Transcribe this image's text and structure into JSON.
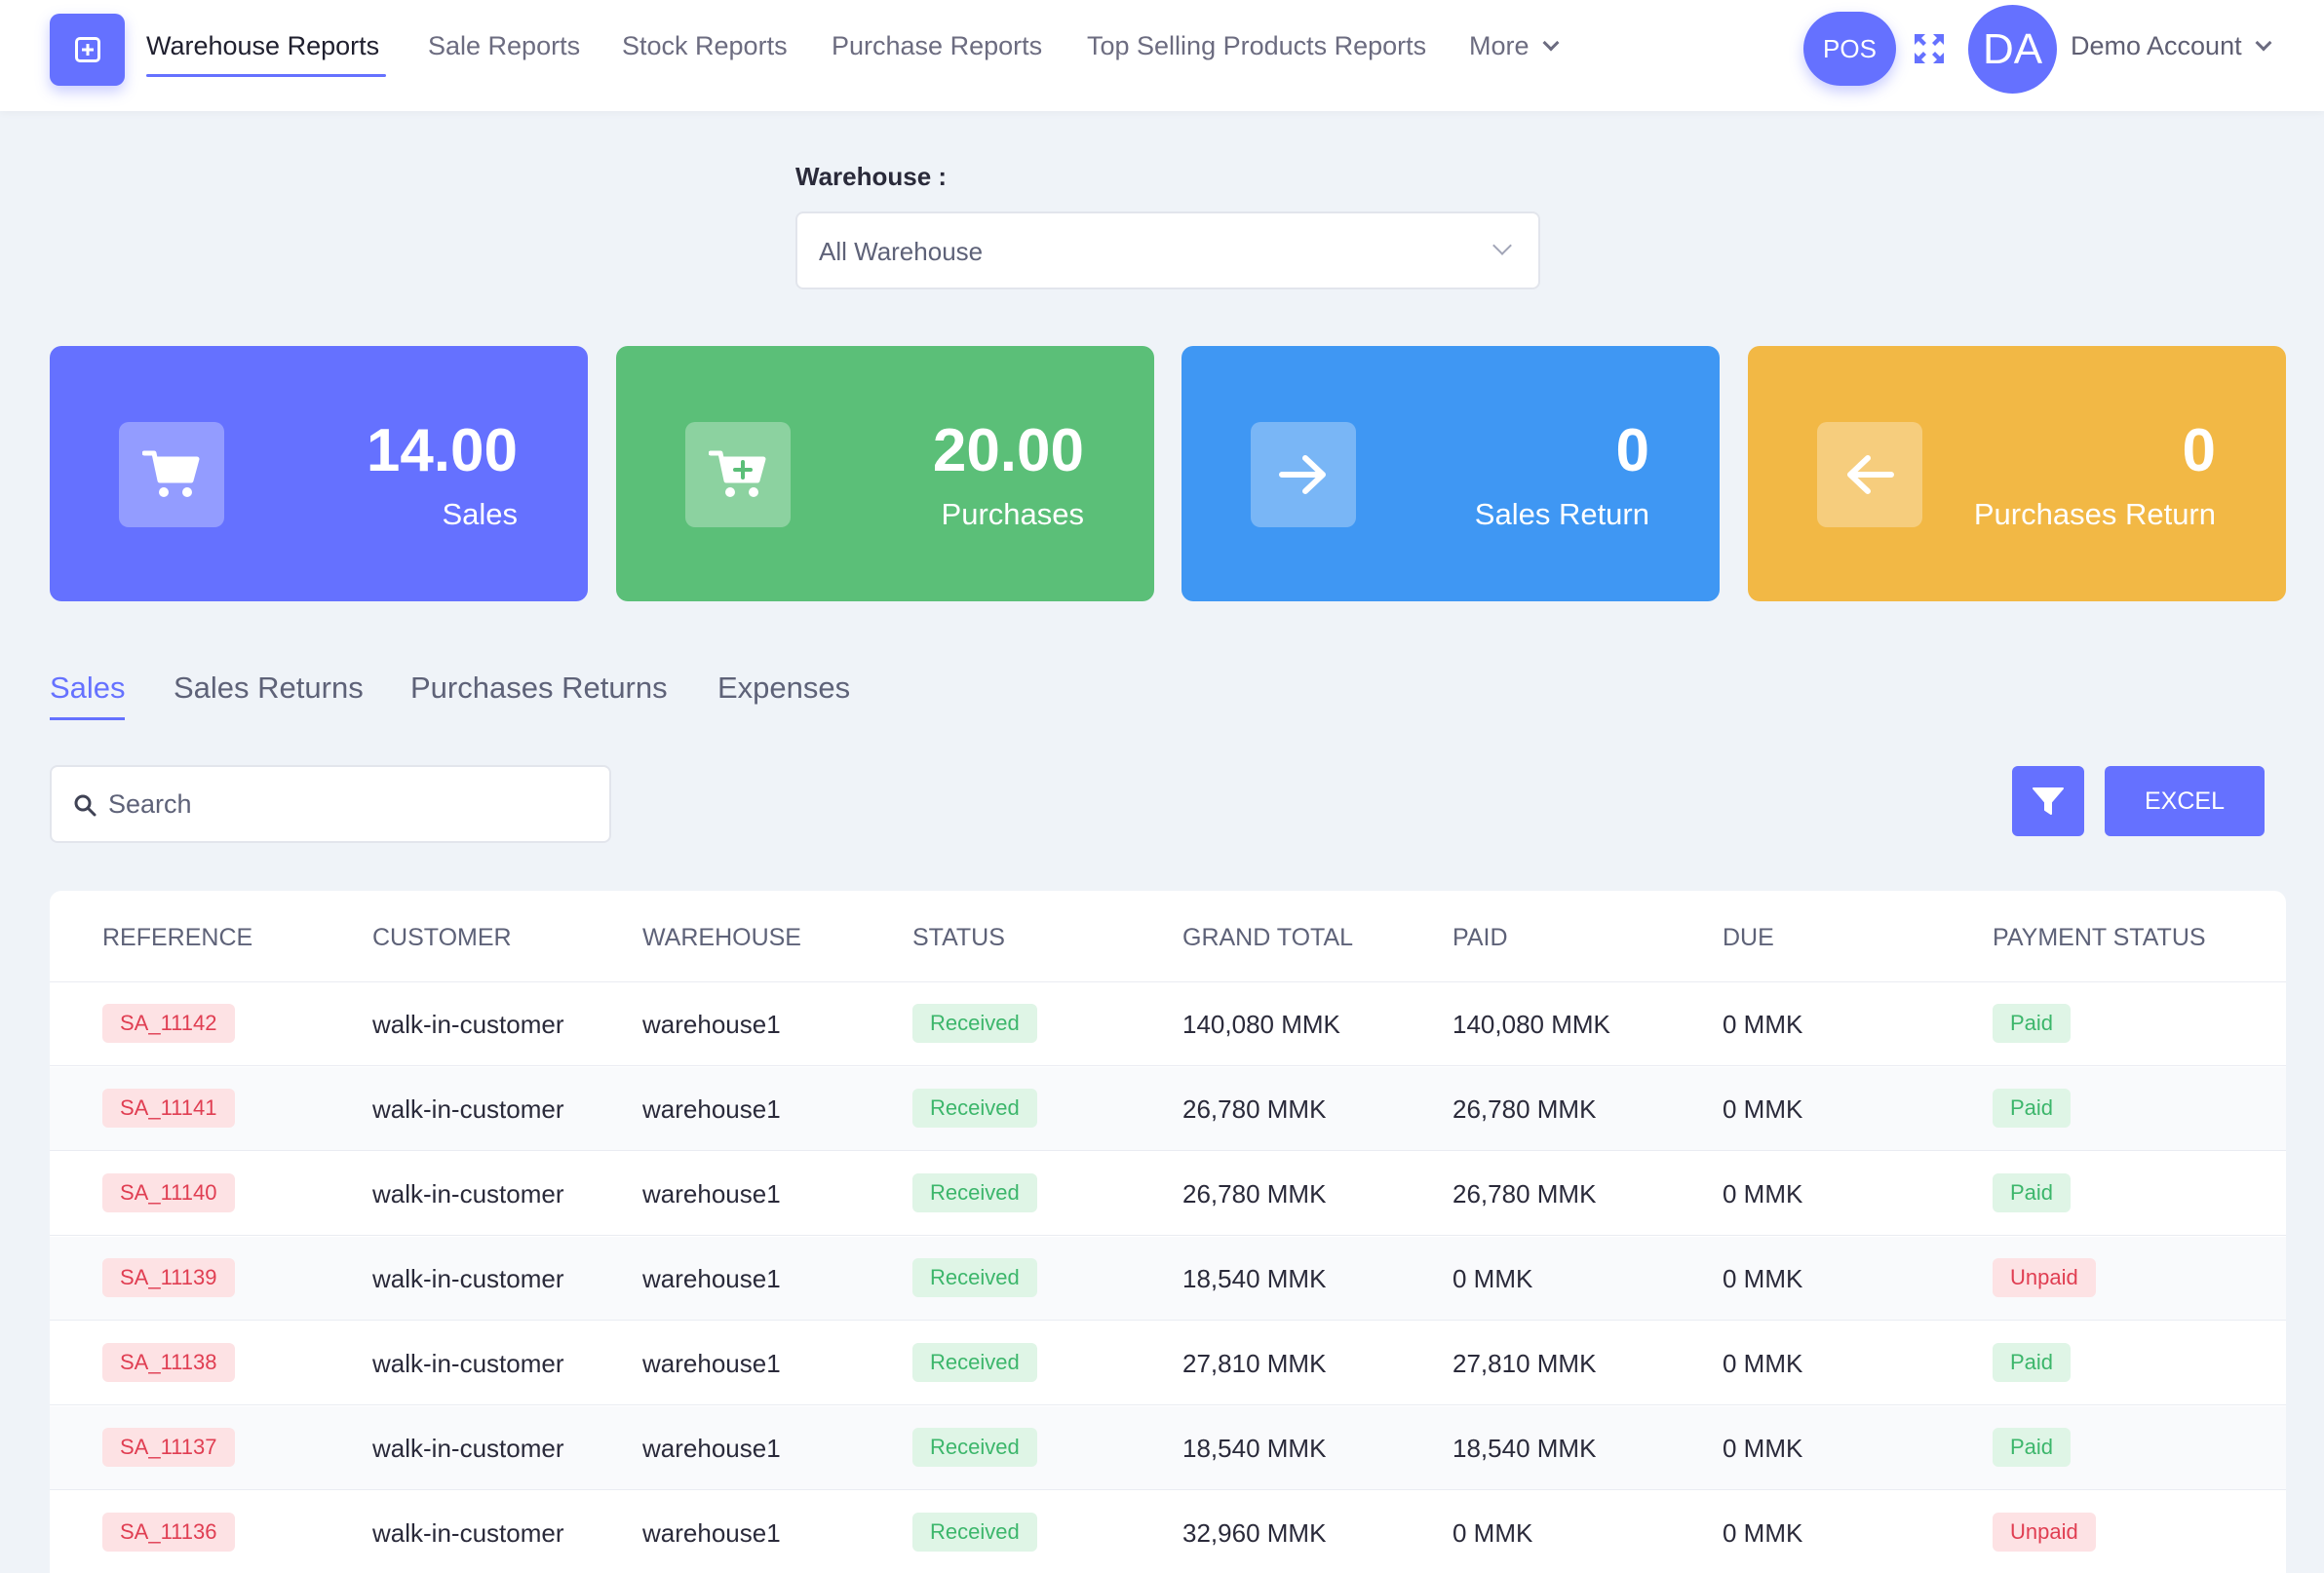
{
  "nav": {
    "items": [
      {
        "label": "Warehouse Reports",
        "active": true
      },
      {
        "label": "Sale Reports"
      },
      {
        "label": "Stock Reports"
      },
      {
        "label": "Purchase Reports"
      },
      {
        "label": "Top Selling Products Reports"
      },
      {
        "label": "More"
      }
    ],
    "pos_label": "POS",
    "avatar_initials": "DA",
    "account_name": "Demo Account"
  },
  "warehouse_filter": {
    "label": "Warehouse :",
    "selected": "All Warehouse"
  },
  "cards": [
    {
      "value": "14.00",
      "label": "Sales",
      "color": "#6571ff",
      "icon": "cart-icon"
    },
    {
      "value": "20.00",
      "label": "Purchases",
      "color": "#5bbf78",
      "icon": "cart-plus-icon"
    },
    {
      "value": "0",
      "label": "Sales Return",
      "color": "#3f97f3",
      "icon": "arrow-right-icon"
    },
    {
      "value": "0",
      "label": "Purchases Return",
      "color": "#f2b845",
      "icon": "arrow-left-icon"
    }
  ],
  "tabs": [
    {
      "label": "Sales",
      "active": true
    },
    {
      "label": "Sales Returns"
    },
    {
      "label": "Purchases Returns"
    },
    {
      "label": "Expenses"
    }
  ],
  "search": {
    "placeholder": "Search"
  },
  "actions": {
    "excel_label": "EXCEL"
  },
  "table": {
    "columns": [
      "REFERENCE",
      "CUSTOMER",
      "WAREHOUSE",
      "STATUS",
      "GRAND TOTAL",
      "PAID",
      "DUE",
      "PAYMENT STATUS"
    ],
    "rows": [
      {
        "reference": "SA_11142",
        "customer": "walk-in-customer",
        "warehouse": "warehouse1",
        "status": "Received",
        "grand_total": "140,080 MMK",
        "paid": "140,080 MMK",
        "due": "0 MMK",
        "payment_status": "Paid"
      },
      {
        "reference": "SA_11141",
        "customer": "walk-in-customer",
        "warehouse": "warehouse1",
        "status": "Received",
        "grand_total": "26,780 MMK",
        "paid": "26,780 MMK",
        "due": "0 MMK",
        "payment_status": "Paid"
      },
      {
        "reference": "SA_11140",
        "customer": "walk-in-customer",
        "warehouse": "warehouse1",
        "status": "Received",
        "grand_total": "26,780 MMK",
        "paid": "26,780 MMK",
        "due": "0 MMK",
        "payment_status": "Paid"
      },
      {
        "reference": "SA_11139",
        "customer": "walk-in-customer",
        "warehouse": "warehouse1",
        "status": "Received",
        "grand_total": "18,540 MMK",
        "paid": "0 MMK",
        "due": "0 MMK",
        "payment_status": "Unpaid"
      },
      {
        "reference": "SA_11138",
        "customer": "walk-in-customer",
        "warehouse": "warehouse1",
        "status": "Received",
        "grand_total": "27,810 MMK",
        "paid": "27,810 MMK",
        "due": "0 MMK",
        "payment_status": "Paid"
      },
      {
        "reference": "SA_11137",
        "customer": "walk-in-customer",
        "warehouse": "warehouse1",
        "status": "Received",
        "grand_total": "18,540 MMK",
        "paid": "18,540 MMK",
        "due": "0 MMK",
        "payment_status": "Paid"
      },
      {
        "reference": "SA_11136",
        "customer": "walk-in-customer",
        "warehouse": "warehouse1",
        "status": "Received",
        "grand_total": "32,960 MMK",
        "paid": "0 MMK",
        "due": "0 MMK",
        "payment_status": "Unpaid"
      }
    ]
  }
}
